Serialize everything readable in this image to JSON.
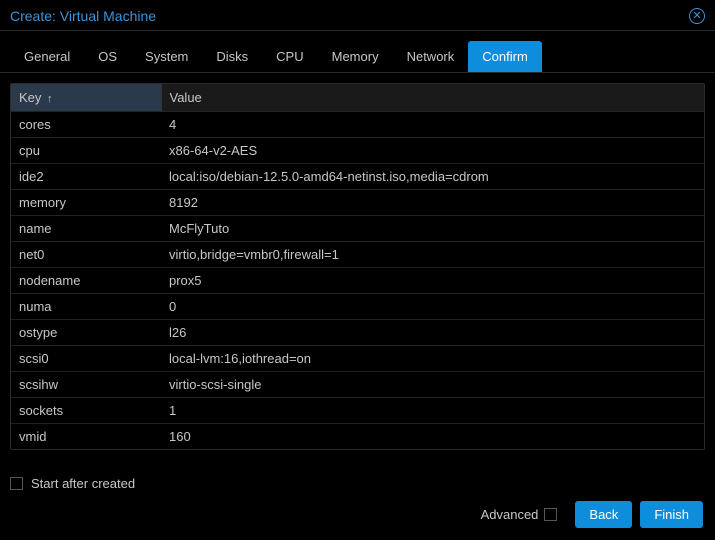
{
  "dialog": {
    "title": "Create: Virtual Machine"
  },
  "tabs": [
    {
      "label": "General"
    },
    {
      "label": "OS"
    },
    {
      "label": "System"
    },
    {
      "label": "Disks"
    },
    {
      "label": "CPU"
    },
    {
      "label": "Memory"
    },
    {
      "label": "Network"
    },
    {
      "label": "Confirm",
      "active": true
    }
  ],
  "table": {
    "headers": {
      "key": "Key",
      "value": "Value"
    },
    "sort_indicator": "↑",
    "rows": [
      {
        "key": "cores",
        "value": "4"
      },
      {
        "key": "cpu",
        "value": "x86-64-v2-AES"
      },
      {
        "key": "ide2",
        "value": "local:iso/debian-12.5.0-amd64-netinst.iso,media=cdrom"
      },
      {
        "key": "memory",
        "value": "8192"
      },
      {
        "key": "name",
        "value": "McFlyTuto"
      },
      {
        "key": "net0",
        "value": "virtio,bridge=vmbr0,firewall=1"
      },
      {
        "key": "nodename",
        "value": "prox5"
      },
      {
        "key": "numa",
        "value": "0"
      },
      {
        "key": "ostype",
        "value": "l26"
      },
      {
        "key": "scsi0",
        "value": "local-lvm:16,iothread=on"
      },
      {
        "key": "scsihw",
        "value": "virtio-scsi-single"
      },
      {
        "key": "sockets",
        "value": "1"
      },
      {
        "key": "vmid",
        "value": "160"
      }
    ]
  },
  "options": {
    "start_after_created_label": "Start after created",
    "start_after_created_checked": false,
    "advanced_label": "Advanced",
    "advanced_checked": false
  },
  "buttons": {
    "back": "Back",
    "finish": "Finish"
  }
}
